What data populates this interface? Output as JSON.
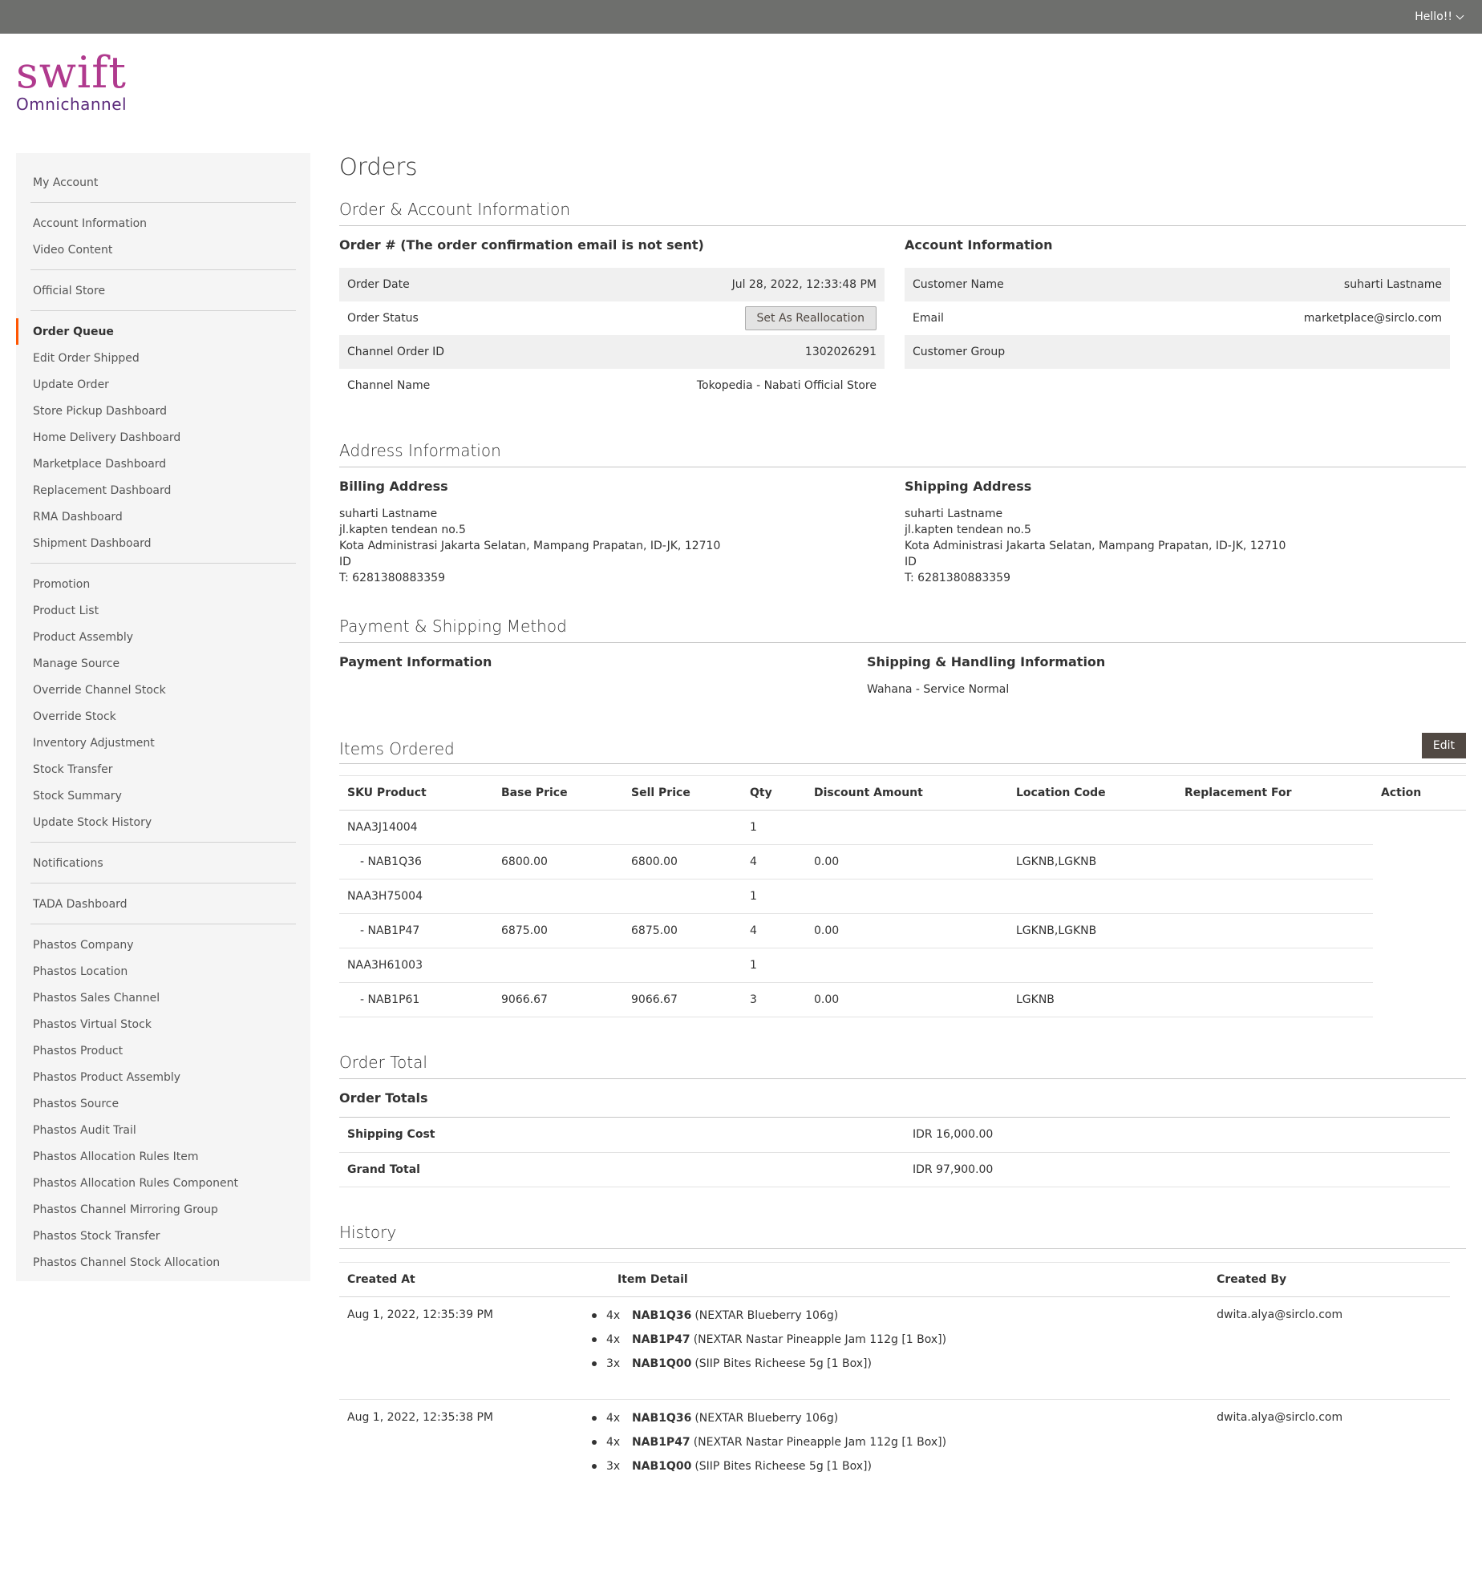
{
  "header": {
    "user_greeting": "Hello!!"
  },
  "logo": {
    "word": "swift",
    "sub": "Omnichannel"
  },
  "sidebar": {
    "groups": [
      [
        "My Account"
      ],
      [
        "Account Information",
        "Video Content"
      ],
      [
        "Official Store"
      ],
      [
        "Order Queue",
        "Edit Order Shipped",
        "Update Order",
        "Store Pickup Dashboard",
        "Home Delivery Dashboard",
        "Marketplace Dashboard",
        "Replacement Dashboard",
        "RMA Dashboard",
        "Shipment Dashboard"
      ],
      [
        "Promotion",
        "Product List",
        "Product Assembly",
        "Manage Source",
        "Override Channel Stock",
        "Override Stock",
        "Inventory Adjustment",
        "Stock Transfer",
        "Stock Summary",
        "Update Stock History"
      ],
      [
        "Notifications"
      ],
      [
        "TADA Dashboard"
      ],
      [
        "Phastos Company",
        "Phastos Location",
        "Phastos Sales Channel",
        "Phastos Virtual Stock",
        "Phastos Product",
        "Phastos Product Assembly",
        "Phastos Source",
        "Phastos Audit Trail",
        "Phastos Allocation Rules Item",
        "Phastos Allocation Rules Component",
        "Phastos Channel Mirroring Group",
        "Phastos Stock Transfer",
        "Phastos Channel Stock Allocation"
      ]
    ],
    "active": "Order Queue"
  },
  "page_title": "Orders",
  "order_account": {
    "section_title": "Order & Account Information",
    "order_title": "Order # (The order confirmation email is not sent)",
    "order_date_label": "Order Date",
    "order_date": "Jul 28, 2022, 12:33:48 PM",
    "order_status_label": "Order Status",
    "reallocation_button": "Set As Reallocation",
    "channel_order_id_label": "Channel Order ID",
    "channel_order_id": "1302026291",
    "channel_name_label": "Channel Name",
    "channel_name": "Tokopedia - Nabati Official Store",
    "account_title": "Account Information",
    "customer_name_label": "Customer Name",
    "customer_name": "suharti Lastname",
    "email_label": "Email",
    "email": "marketplace@sirclo.com",
    "customer_group_label": "Customer Group"
  },
  "address": {
    "section_title": "Address Information",
    "billing_title": "Billing Address",
    "billing": [
      "suharti Lastname",
      "jl.kapten tendean no.5",
      "Kota Administrasi Jakarta Selatan, Mampang Prapatan, ID-JK, 12710",
      "ID",
      "T: 6281380883359"
    ],
    "shipping_title": "Shipping Address",
    "shipping": [
      "suharti Lastname",
      "jl.kapten tendean no.5",
      "Kota Administrasi Jakarta Selatan, Mampang Prapatan, ID-JK, 12710",
      "ID",
      "T: 6281380883359"
    ]
  },
  "payment": {
    "section_title": "Payment & Shipping Method",
    "payment_title": "Payment Information",
    "shipping_title": "Shipping & Handling Information",
    "shipping_method": "Wahana - Service Normal"
  },
  "items": {
    "section_title": "Items Ordered",
    "edit_button": "Edit",
    "columns": [
      "SKU Product",
      "Base Price",
      "Sell Price",
      "Qty",
      "Discount Amount",
      "Location Code",
      "Replacement For",
      "Action"
    ],
    "rows": [
      [
        "NAA3J14004",
        "",
        "",
        "1",
        "",
        "",
        "",
        ""
      ],
      [
        "- NAB1Q36",
        "6800.00",
        "6800.00",
        "4",
        "0.00",
        "LGKNB,LGKNB",
        "",
        ""
      ],
      [
        "NAA3H75004",
        "",
        "",
        "1",
        "",
        "",
        "",
        ""
      ],
      [
        "- NAB1P47",
        "6875.00",
        "6875.00",
        "4",
        "0.00",
        "LGKNB,LGKNB",
        "",
        ""
      ],
      [
        "NAA3H61003",
        "",
        "",
        "1",
        "",
        "",
        "",
        ""
      ],
      [
        "- NAB1P61",
        "9066.67",
        "9066.67",
        "3",
        "0.00",
        "LGKNB",
        "",
        ""
      ]
    ]
  },
  "totals": {
    "section_title": "Order Total",
    "sub_title": "Order Totals",
    "rows": [
      [
        "Shipping Cost",
        "IDR 16,000.00"
      ],
      [
        "Grand Total",
        "IDR 97,900.00"
      ]
    ]
  },
  "history": {
    "section_title": "History",
    "columns": [
      "Created At",
      "Item Detail",
      "Created By"
    ],
    "entries": [
      {
        "created_at": "Aug 1, 2022, 12:35:39 PM",
        "created_by": "dwita.alya@sirclo.com",
        "items": [
          [
            "4x",
            "NAB1Q36",
            "(NEXTAR Blueberry 106g)"
          ],
          [
            "4x",
            "NAB1P47",
            "(NEXTAR Nastar Pineapple Jam 112g [1 Box])"
          ],
          [
            "3x",
            "NAB1Q00",
            "(SIIP Bites Richeese 5g [1 Box])"
          ]
        ]
      },
      {
        "created_at": "Aug 1, 2022, 12:35:38 PM",
        "created_by": "dwita.alya@sirclo.com",
        "items": [
          [
            "4x",
            "NAB1Q36",
            "(NEXTAR Blueberry 106g)"
          ],
          [
            "4x",
            "NAB1P47",
            "(NEXTAR Nastar Pineapple Jam 112g [1 Box])"
          ],
          [
            "3x",
            "NAB1Q00",
            "(SIIP Bites Richeese 5g [1 Box])"
          ]
        ]
      }
    ]
  }
}
